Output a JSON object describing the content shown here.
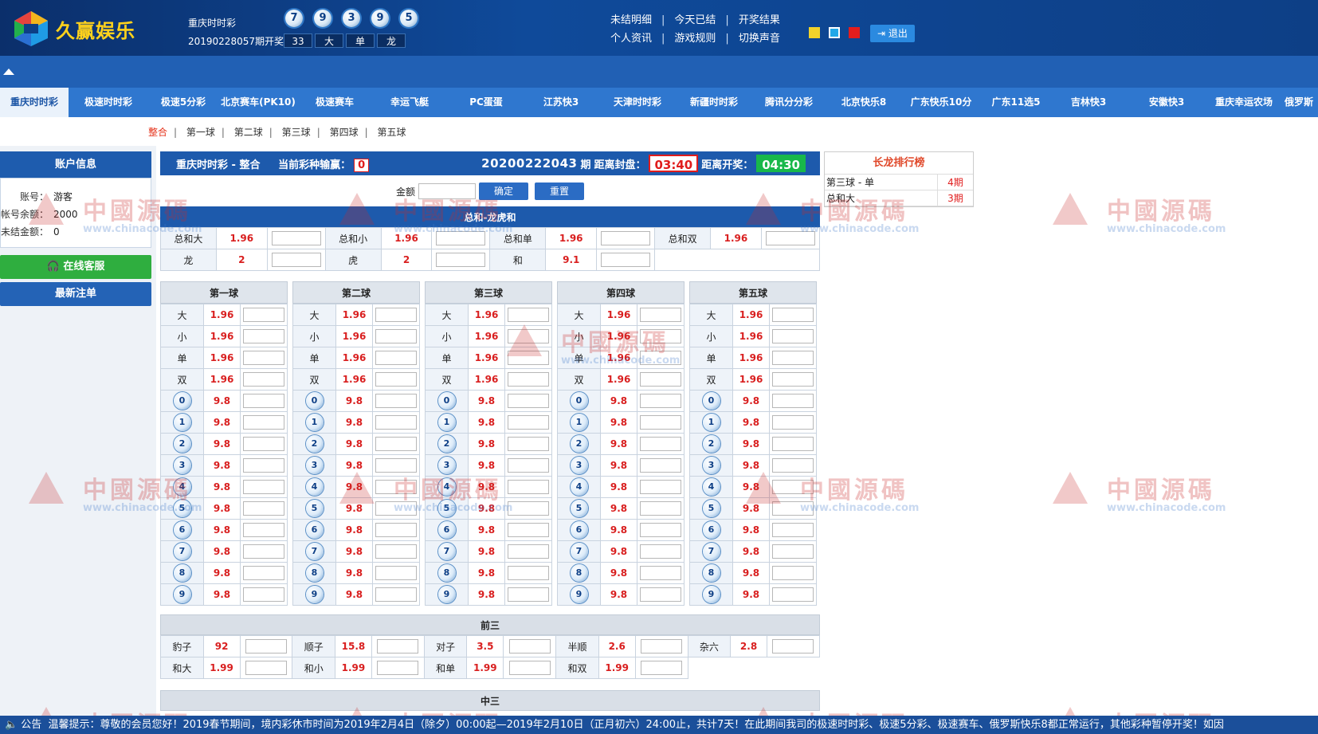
{
  "header": {
    "brand": "久赢娱乐",
    "lottery_name": "重庆时时彩",
    "issue_label": "20190228057期开奖",
    "balls": [
      "7",
      "9",
      "3",
      "9",
      "5"
    ],
    "result_tags": [
      "33",
      "大",
      "单",
      "龙"
    ],
    "links_row1": [
      "未结明细",
      "今天已结",
      "开奖结果"
    ],
    "links_row2": [
      "个人资讯",
      "游戏规则",
      "切换声音"
    ],
    "logout": "退出",
    "swatch_colors": [
      "#f2d22b",
      "#21a8e8",
      "#e31d1d"
    ]
  },
  "nav": {
    "tabs": [
      "重庆时时彩",
      "极速时时彩",
      "极速5分彩",
      "北京赛车(PK10)",
      "极速赛车",
      "幸运飞艇",
      "PC蛋蛋",
      "江苏快3",
      "天津时时彩",
      "新疆时时彩",
      "腾讯分分彩",
      "北京快乐8",
      "广东快乐10分",
      "广东11选5",
      "吉林快3",
      "安徽快3",
      "重庆幸运农场",
      "俄罗斯"
    ]
  },
  "subnav": [
    "整合",
    "第一球",
    "第二球",
    "第三球",
    "第四球",
    "第五球"
  ],
  "account": {
    "title": "账户信息",
    "rows": [
      {
        "k": "账号：",
        "v": "游客"
      },
      {
        "k": "帐号余额：",
        "v": "2000"
      },
      {
        "k": "未结金额：",
        "v": "0"
      }
    ],
    "cs_button": "在线客服",
    "latest_button": "最新注单"
  },
  "main": {
    "title": "重庆时时彩 - 整合",
    "winloss_label": "当前彩种输赢：",
    "winloss": "0",
    "issue": "20200222043",
    "issue_suffix": "期",
    "close_label": "距离封盘：",
    "close_time": "03:40",
    "open_label": "距离开奖：",
    "open_time": "04:30",
    "amount_label": "金额",
    "confirm": "确定",
    "reset": "重置"
  },
  "total": {
    "title": "总和-龙虎和",
    "row1": [
      {
        "label": "总和大",
        "odds": "1.96"
      },
      {
        "label": "总和小",
        "odds": "1.96"
      },
      {
        "label": "总和单",
        "odds": "1.96"
      },
      {
        "label": "总和双",
        "odds": "1.96"
      }
    ],
    "row2": [
      {
        "label": "龙",
        "odds": "2"
      },
      {
        "label": "虎",
        "odds": "2"
      },
      {
        "label": "和",
        "odds": "9.1"
      }
    ]
  },
  "balls_section": {
    "columns": [
      "第一球",
      "第二球",
      "第三球",
      "第四球",
      "第五球"
    ],
    "bs": [
      {
        "label": "大",
        "odds": "1.96"
      },
      {
        "label": "小",
        "odds": "1.96"
      },
      {
        "label": "单",
        "odds": "1.96"
      },
      {
        "label": "双",
        "odds": "1.96"
      }
    ],
    "nums": [
      "0",
      "1",
      "2",
      "3",
      "4",
      "5",
      "6",
      "7",
      "8",
      "9"
    ],
    "num_odds": "9.8"
  },
  "front3": {
    "title": "前三",
    "row1": [
      {
        "label": "豹子",
        "odds": "92"
      },
      {
        "label": "顺子",
        "odds": "15.8"
      },
      {
        "label": "对子",
        "odds": "3.5"
      },
      {
        "label": "半顺",
        "odds": "2.6"
      },
      {
        "label": "杂六",
        "odds": "2.8"
      }
    ],
    "row2": [
      {
        "label": "和大",
        "odds": "1.99"
      },
      {
        "label": "和小",
        "odds": "1.99"
      },
      {
        "label": "和单",
        "odds": "1.99"
      },
      {
        "label": "和双",
        "odds": "1.99"
      }
    ]
  },
  "mid3": {
    "title": "中三"
  },
  "rank": {
    "title": "长龙排行榜",
    "rows": [
      {
        "a": "第三球 - 单",
        "b": "4期"
      },
      {
        "a": "总和大",
        "b": "3期"
      }
    ]
  },
  "ticker": {
    "label": "公告",
    "text": "温馨提示：尊敬的会员您好！2019春节期间，境内彩休市时间为2019年2月4日（除夕）00:00起—2019年2月10日（正月初六）24:00止，共计7天！在此期间我司的极速时时彩、极速5分彩、极速赛车、俄罗斯快乐8都正常运行，其他彩种暂停开奖！如因"
  },
  "watermark": {
    "text": "中國源碼",
    "url": "www.chinacode.com"
  }
}
